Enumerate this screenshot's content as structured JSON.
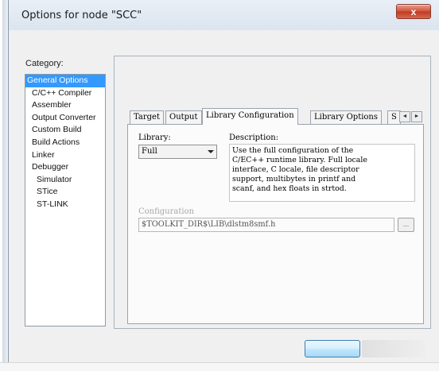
{
  "window": {
    "title": "Options for node \"SCC\"",
    "close_label": "x"
  },
  "category": {
    "label": "Category:",
    "items": [
      {
        "label": "General Options",
        "selected": true,
        "indent": 0
      },
      {
        "label": "C/C++ Compiler",
        "indent": 1
      },
      {
        "label": "Assembler",
        "indent": 1
      },
      {
        "label": "Output Converter",
        "indent": 1
      },
      {
        "label": "Custom Build",
        "indent": 1
      },
      {
        "label": "Build Actions",
        "indent": 1
      },
      {
        "label": "Linker",
        "indent": 1
      },
      {
        "label": "Debugger",
        "indent": 1
      },
      {
        "label": "Simulator",
        "indent": 2
      },
      {
        "label": "STice",
        "indent": 2
      },
      {
        "label": "ST-LINK",
        "indent": 2
      }
    ]
  },
  "tabs": [
    {
      "label": "Target"
    },
    {
      "label": "Output"
    },
    {
      "label": "Library Configuration",
      "active": true
    },
    {
      "label": "Library Options"
    },
    {
      "label": "S"
    }
  ],
  "tab_scroll": {
    "left": "◄",
    "right": "►"
  },
  "library": {
    "label": "Library:",
    "value": "Full"
  },
  "description": {
    "label": "Description:",
    "lines": [
      "Use the full configuration of the",
      "C/EC++ runtime library. Full locale",
      "interface, C locale, file descriptor",
      "support, multibytes in printf and",
      "scanf, and hex floats in strtod."
    ]
  },
  "configuration": {
    "label": "Configuration",
    "value": "$TOOLKIT_DIR$\\LIB\\dlstm8smf.h",
    "browse_label": "..."
  },
  "colors": {
    "selection": "#3399ff",
    "close_button": "#c13a22",
    "disabled_text": "#a8a8a8"
  }
}
